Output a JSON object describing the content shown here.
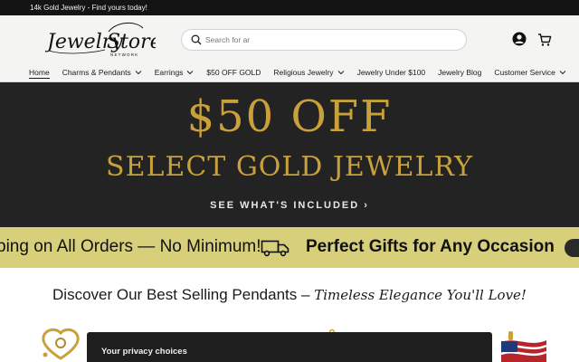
{
  "announcement": {
    "text": "14k Gold Jewelry - Find yours today!"
  },
  "header": {
    "logo": {
      "brand": "JewelryStores",
      "subtitle": "NETWORK"
    },
    "search": {
      "placeholder": "Search for ar",
      "value": ""
    },
    "icons": {
      "account": "account-icon",
      "cart": "cart-icon",
      "search": "search-icon"
    }
  },
  "nav": {
    "items": [
      {
        "label": "Home",
        "active": true,
        "dropdown": false
      },
      {
        "label": "Charms & Pendants",
        "active": false,
        "dropdown": true
      },
      {
        "label": "Earrings",
        "active": false,
        "dropdown": true
      },
      {
        "label": "$50 OFF GOLD",
        "active": false,
        "dropdown": false
      },
      {
        "label": "Religious Jewelry",
        "active": false,
        "dropdown": true
      },
      {
        "label": "Jewelry Under $100",
        "active": false,
        "dropdown": false
      },
      {
        "label": "Jewelry Blog",
        "active": false,
        "dropdown": false
      },
      {
        "label": "Customer Service",
        "active": false,
        "dropdown": true
      }
    ]
  },
  "hero": {
    "headline": "$50 OFF",
    "subheadline": "SELECT GOLD JEWELRY",
    "cta": "SEE WHAT'S INCLUDED ›",
    "colors": {
      "background": "#232323",
      "gold": "#c9a13a"
    }
  },
  "marquee": {
    "text1": "ping on All Orders — No Minimum!",
    "text2": "Perfect Gifts for Any Occasion",
    "icon": "truck-icon",
    "background": "#d7cf79"
  },
  "section": {
    "title": "Discover Our Best Selling Pendants – ",
    "script": "Timeless Elegance You'll Love!"
  },
  "privacy": {
    "title": "Your privacy choices"
  }
}
